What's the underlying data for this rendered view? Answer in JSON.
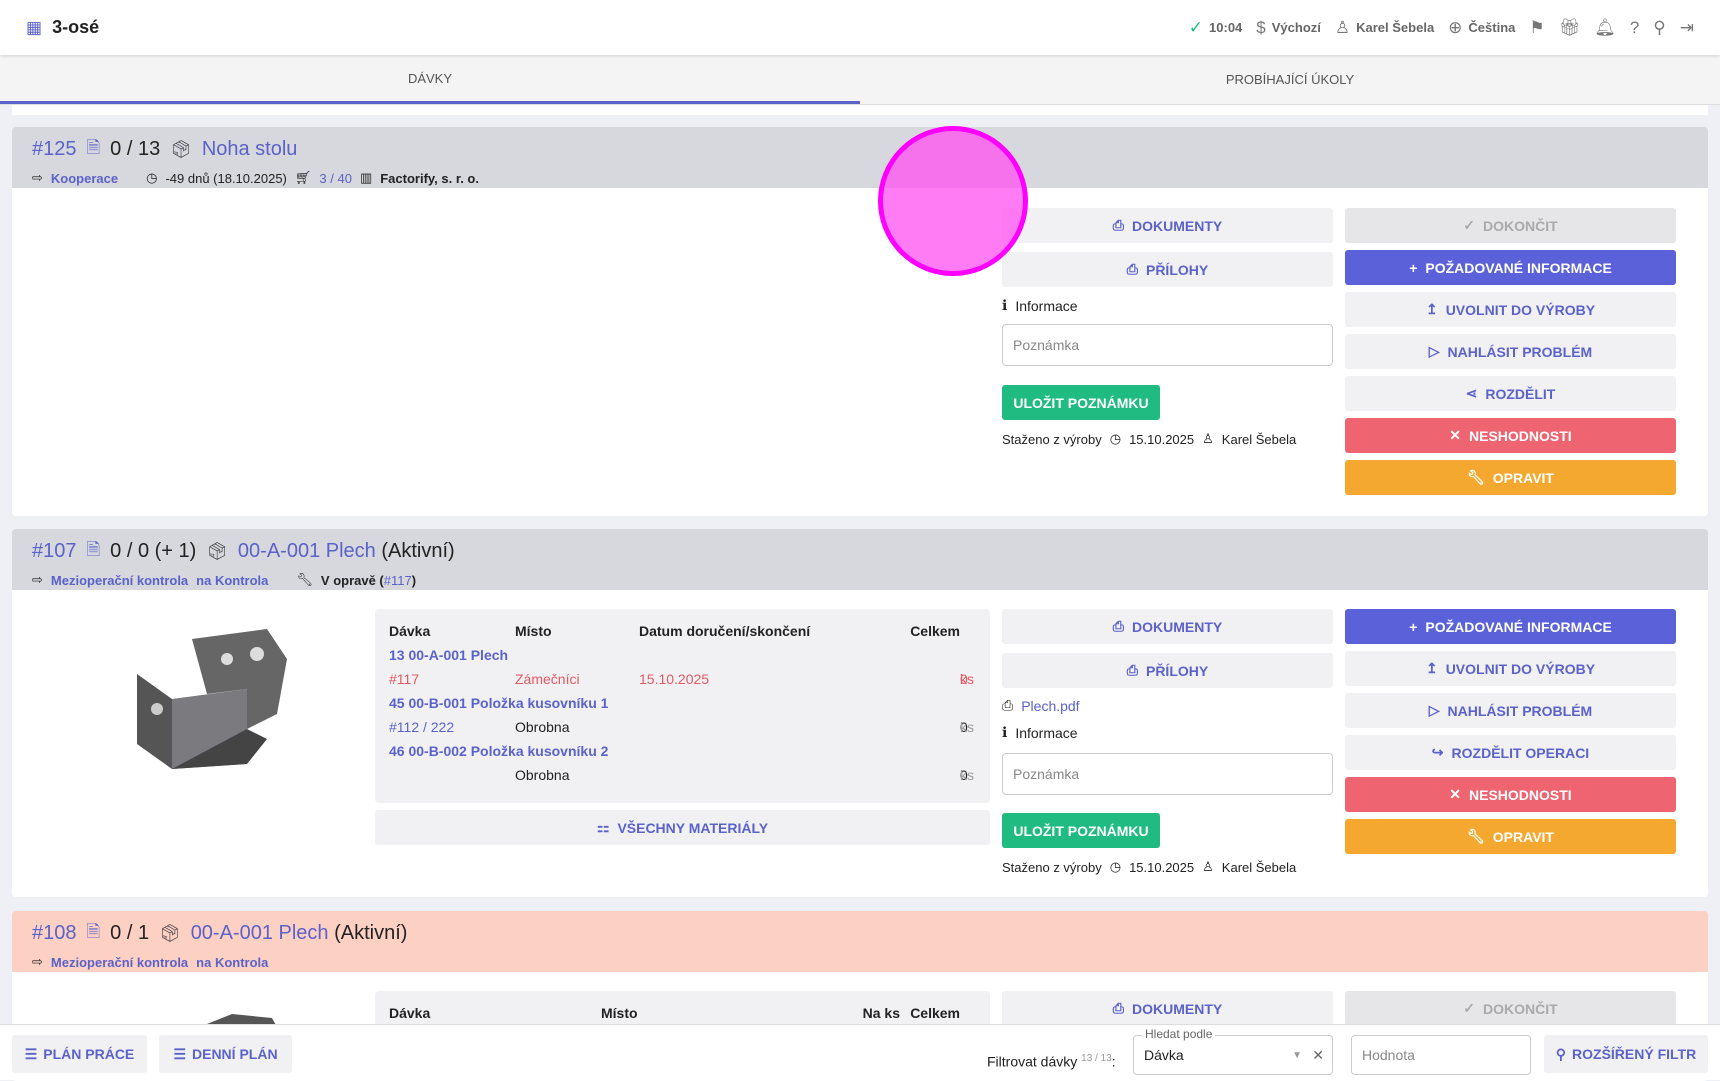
{
  "header": {
    "title": "3-osé",
    "time": "10:04",
    "currency": "Výchozí",
    "user": "Karel Šebela",
    "language": "Čeština"
  },
  "tabs": [
    {
      "label": "DÁVKY"
    },
    {
      "label": "PROBÍHAJÍCÍ ÚKOLY"
    }
  ],
  "cards": [
    {
      "id": "#125",
      "count": "0 / 13",
      "name": "Noha stolu",
      "operation": "Kooperace",
      "deadline": "-49 dnů (18.10.2025)",
      "cart": "3 / 40",
      "company": "Factorify, s. r. o.",
      "docs": "DOKUMENTY",
      "attach": "PŘÍLOHY",
      "info": "Informace",
      "note_placeholder": "Poznámka",
      "save": "ULOŽIT POZNÁMKU",
      "withdrawn": "Staženo z výroby",
      "date": "15.10.2025",
      "user": "Karel Šebela",
      "actions": [
        "DOKONČIT",
        "POŽADOVANÉ INFORMACE",
        "UVOLNIT DO VÝROBY",
        "NAHLÁSIT PROBLÉM",
        "ROZDĚLIT",
        "NESHODNOSTI",
        "OPRAVIT"
      ]
    },
    {
      "id": "#107",
      "count": "0 / 0 (+ 1)",
      "name": "00-A-001 Plech",
      "state": "(Aktivní)",
      "operation": "Mezioperační kontrola",
      "place": "na Kontrola",
      "repair": "V opravě (",
      "repair_link": "#117",
      "repair_end": ")",
      "table": {
        "headers": [
          "Dávka",
          "Místo",
          "Datum doručení/skončení",
          "Celkem"
        ],
        "rows": [
          {
            "group": "13 00-A-001 Plech"
          },
          {
            "a": "#117",
            "b": "Zámečníci",
            "c": "15.10.2025",
            "n": "0",
            "u": "ks"
          },
          {
            "group": "45 00-B-001 Položka kusovníku 1"
          },
          {
            "a": "#112 / 222",
            "b": "Obrobna",
            "c": "",
            "n": "0",
            "u": "ks"
          },
          {
            "group": "46 00-B-002 Položka kusovníku 2"
          },
          {
            "a": "",
            "b": "Obrobna",
            "c": "",
            "n": "0",
            "u": "ks"
          }
        ]
      },
      "materials": "VŠECHNY MATERIÁLY",
      "docs": "DOKUMENTY",
      "attach": "PŘÍLOHY",
      "file": "Plech.pdf",
      "info": "Informace",
      "note_placeholder": "Poznámka",
      "save": "ULOŽIT POZNÁMKU",
      "withdrawn": "Staženo z výroby",
      "date": "15.10.2025",
      "user": "Karel Šebela",
      "actions": [
        "POŽADOVANÉ INFORMACE",
        "UVOLNIT DO VÝROBY",
        "NAHLÁSIT PROBLÉM",
        "ROZDĚLIT OPERACI",
        "NESHODNOSTI",
        "OPRAVIT"
      ]
    },
    {
      "id": "#108",
      "count": "0 / 1",
      "name": "00-A-001 Plech",
      "state": "(Aktivní)",
      "operation": "Mezioperační kontrola",
      "place": "na Kontrola",
      "table": {
        "headers": [
          "Dávka",
          "Místo",
          "Na ks",
          "Celkem"
        ]
      },
      "docs": "DOKUMENTY",
      "finish": "DOKONČIT"
    }
  ],
  "bottom": {
    "work_plan": "PLÁN PRÁCE",
    "daily_plan": "DENNÍ PLÁN",
    "filter_label": "Filtrovat dávky",
    "filter_count": "13 / 13",
    "search_by_label": "Hledat podle",
    "search_by_value": "Dávka",
    "value_placeholder": "Hodnota",
    "advanced": "ROZŠÍŘENÝ FILTR"
  }
}
